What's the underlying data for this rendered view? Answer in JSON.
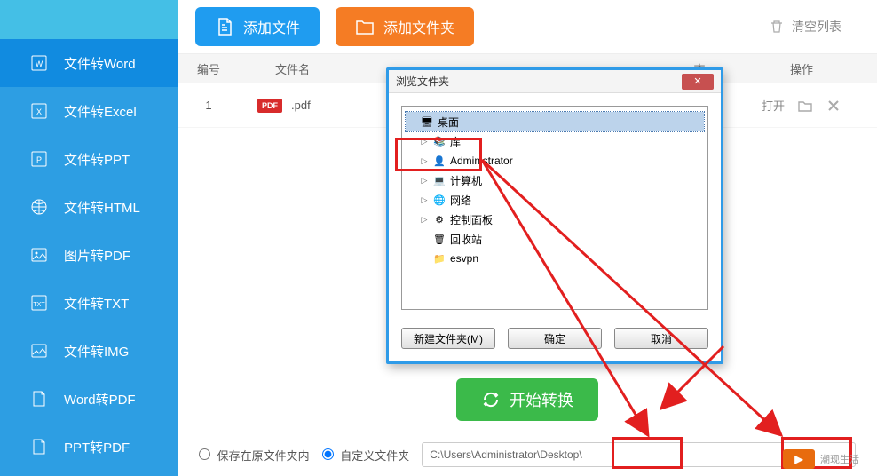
{
  "sidebar": {
    "items": [
      {
        "label": "文件转Word"
      },
      {
        "label": "文件转Excel"
      },
      {
        "label": "文件转PPT"
      },
      {
        "label": "文件转HTML"
      },
      {
        "label": "图片转PDF"
      },
      {
        "label": "文件转TXT"
      },
      {
        "label": "文件转IMG"
      },
      {
        "label": "Word转PDF"
      },
      {
        "label": "PPT转PDF"
      }
    ]
  },
  "toolbar": {
    "add_file": "添加文件",
    "add_folder": "添加文件夹",
    "clear_list": "清空列表"
  },
  "table": {
    "headers": {
      "num": "编号",
      "name": "文件名",
      "status": "态",
      "ops": "操作"
    },
    "rows": [
      {
        "num": "1",
        "name": ".pdf",
        "open": "打开"
      }
    ]
  },
  "convert_btn": "开始转换",
  "footer": {
    "save_in_original": "保存在原文件夹内",
    "custom_folder": "自定义文件夹",
    "path": "C:\\Users\\Administrator\\Desktop\\"
  },
  "dialog": {
    "title": "浏览文件夹",
    "tree": [
      {
        "label": "桌面",
        "icon": "🖥",
        "selected": true,
        "expand": ""
      },
      {
        "label": "库",
        "icon": "📚",
        "expand": "▷",
        "indent": 1
      },
      {
        "label": "Administrator",
        "icon": "👤",
        "expand": "▷",
        "indent": 1
      },
      {
        "label": "计算机",
        "icon": "💻",
        "expand": "▷",
        "indent": 1
      },
      {
        "label": "网络",
        "icon": "🌐",
        "expand": "▷",
        "indent": 1
      },
      {
        "label": "控制面板",
        "icon": "⚙",
        "expand": "▷",
        "indent": 1
      },
      {
        "label": "回收站",
        "icon": "🗑",
        "expand": "",
        "indent": 1
      },
      {
        "label": "esvpn",
        "icon": "📁",
        "expand": "",
        "indent": 1
      }
    ],
    "new_folder": "新建文件夹(M)",
    "ok": "确定",
    "cancel": "取消"
  },
  "watermark": "潮现生活"
}
